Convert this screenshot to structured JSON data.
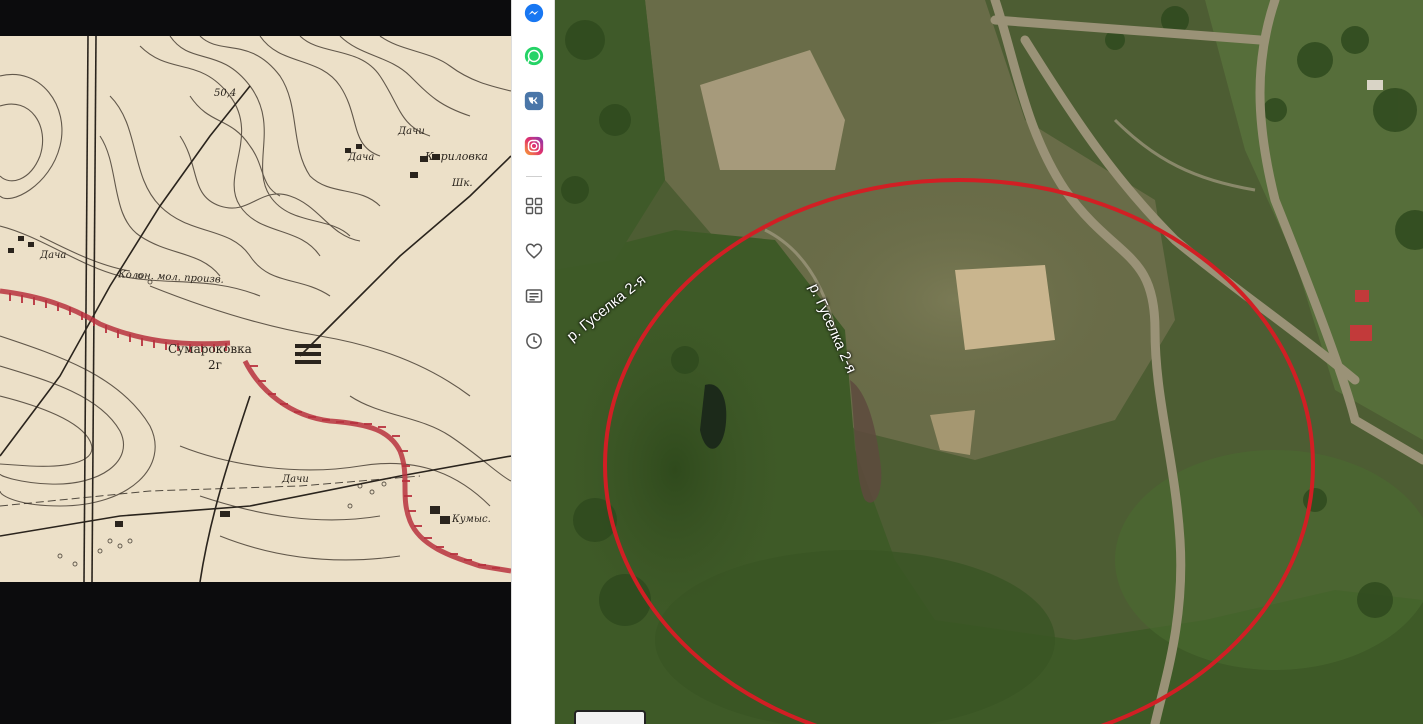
{
  "old_map": {
    "labels": {
      "elev": "50,4",
      "dachi_1": "Дачи",
      "dacha_2": "Дача",
      "kirillovka": "Кириловка",
      "shk": "Шк.",
      "dacha_3": "Дача",
      "kolon": "Колон. мол. произв.",
      "sumarokovka": "Сумароковка",
      "num": "2г",
      "dachi_bottom": "Дачи",
      "kumys": "Кумыс."
    }
  },
  "sidebar": {
    "items": [
      {
        "icon": "messenger-icon",
        "color": "#1877f2"
      },
      {
        "icon": "whatsapp-icon",
        "color": "#25d366"
      },
      {
        "icon": "vk-icon",
        "color": "#4a76a8"
      },
      {
        "icon": "instagram-icon",
        "color": "#e1306c"
      },
      {
        "icon": "apps-grid-icon",
        "color": "#555555"
      },
      {
        "icon": "heart-icon",
        "color": "#555555"
      },
      {
        "icon": "reading-list-icon",
        "color": "#555555"
      },
      {
        "icon": "history-clock-icon",
        "color": "#555555"
      }
    ]
  },
  "satellite": {
    "river_label_1": "р. Гуселка 2-я",
    "river_label_2": "р. Гуселка 2-я",
    "highlight_circle_color": "#d11f24"
  }
}
